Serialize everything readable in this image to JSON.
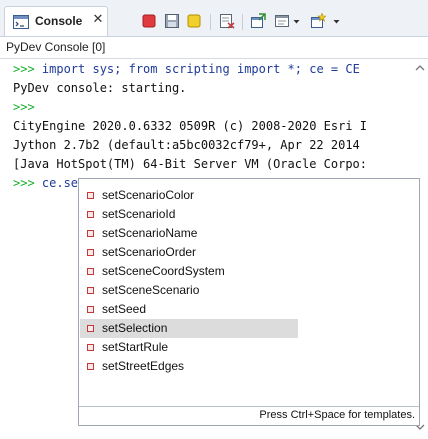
{
  "tab": {
    "label": "Console",
    "close_glyph": "✕"
  },
  "toolbar": {
    "buttons": [
      "terminate-icon",
      "save-icon",
      "pin-icon",
      "clear-console-icon",
      "open-console-icon",
      "display-selected-console-icon",
      "new-console-icon"
    ]
  },
  "console_name": "PyDev Console [0]",
  "lines": [
    {
      "prompt": ">>> ",
      "text": "import sys; from scripting import *; ce = CE"
    },
    {
      "prompt": "",
      "text": "PyDev console: starting."
    },
    {
      "prompt": ">>>",
      "text": ""
    },
    {
      "prompt": "",
      "text": "CityEngine 2020.0.6332 0509R (c) 2008-2020 Esri I"
    },
    {
      "prompt": "",
      "text": "Jython 2.7b2 (default:a5bc0032cf79+, Apr 22 2014"
    },
    {
      "prompt": "",
      "text": "[Java HotSpot(TM) 64-Bit Server VM (Oracle Corpo:"
    },
    {
      "prompt": ">>> ",
      "text": "ce.setS"
    }
  ],
  "autocomplete": {
    "items": [
      "setScenarioColor",
      "setScenarioId",
      "setScenarioName",
      "setScenarioOrder",
      "setSceneCoordSystem",
      "setSceneScenario",
      "setSeed",
      "setSelection",
      "setStartRule",
      "setStreetEdges"
    ],
    "selected_index": 7,
    "footer": "Press Ctrl+Space for templates."
  },
  "colors": {
    "prompt": "#17b02a",
    "command": "#1f3a99",
    "selection": "#dcdcdc"
  }
}
